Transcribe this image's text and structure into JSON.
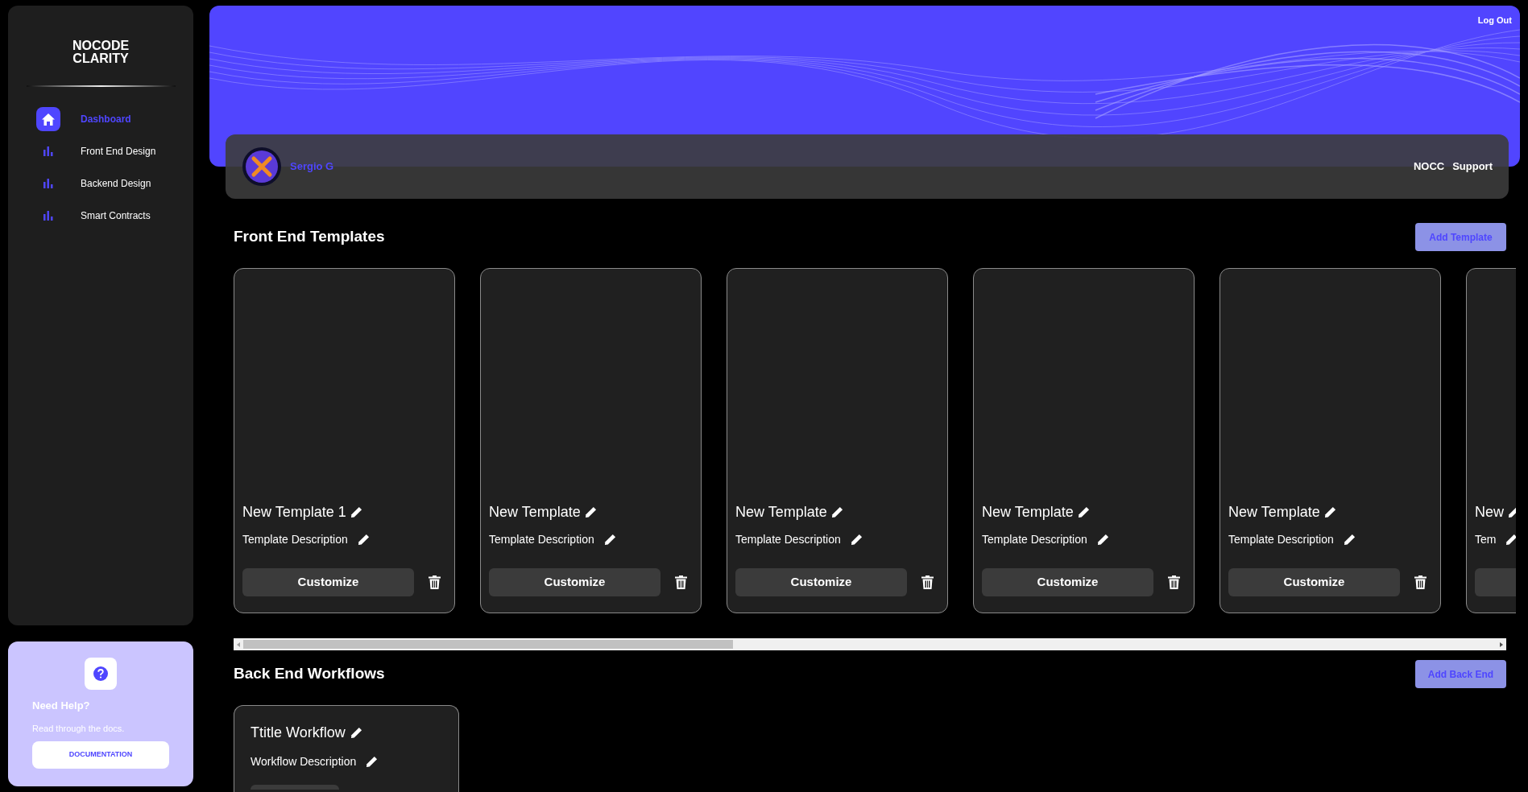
{
  "sidebar": {
    "logo_lines": [
      "NOCODE",
      "CLARITY"
    ],
    "items": [
      {
        "label": "Dashboard",
        "kind": "home",
        "selected": true
      },
      {
        "label": "Front End Design",
        "kind": "chart",
        "selected": false
      },
      {
        "label": "Backend Design",
        "kind": "chart",
        "selected": false
      },
      {
        "label": "Smart Contracts",
        "kind": "chart",
        "selected": false
      }
    ]
  },
  "help": {
    "title": "Need Help?",
    "text": "Read through the docs.",
    "button": "DOCUMENTATION"
  },
  "header": {
    "logout": "Log Out",
    "user": "Sergio G",
    "links": [
      "NOCC",
      "Support"
    ]
  },
  "front_end": {
    "title": "Front End Templates",
    "add_button": "Add Template",
    "cards": [
      {
        "title": "New Template 1",
        "description": "Template Description",
        "button": "Customize"
      },
      {
        "title": "New Template",
        "description": "Template Description",
        "button": "Customize"
      },
      {
        "title": "New Template",
        "description": "Template Description",
        "button": "Customize"
      },
      {
        "title": "New Template",
        "description": "Template Description",
        "button": "Customize"
      },
      {
        "title": "New Template",
        "description": "Template Description",
        "button": "Customize"
      },
      {
        "title": "New",
        "description": "Tem"
      }
    ]
  },
  "back_end": {
    "title": "Back End Workflows",
    "add_button": "Add Back End",
    "cards": [
      {
        "title": "Ttitle Workflow",
        "description": "Workflow Description"
      }
    ]
  }
}
